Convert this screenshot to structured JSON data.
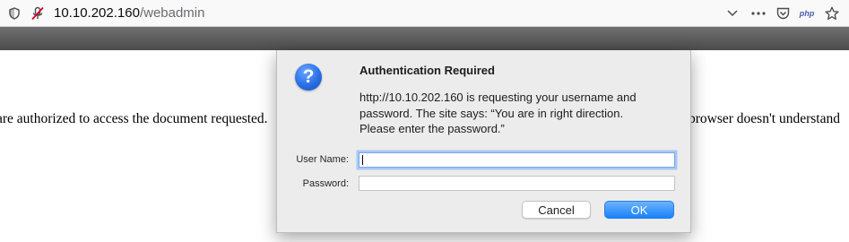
{
  "browser": {
    "url_host": "10.10.202.160",
    "url_path": "/webadmin",
    "icons": {
      "site_info": "shield-icon",
      "permissions": "blocked-microphone-icon",
      "dropdown": "chevron-down-icon",
      "page_actions": "more-dots-icon",
      "pocket": "pocket-icon",
      "extension": "php-extension-icon",
      "bookmark": "star-icon"
    },
    "extension_label": "php"
  },
  "page": {
    "left_text": "are authorized to access the document requested.",
    "right_text": "browser doesn't understand"
  },
  "dialog": {
    "icon": "question-icon",
    "icon_glyph": "?",
    "title": "Authentication Required",
    "message_lines": [
      "http://10.10.202.160 is requesting your username and",
      "password. The site says: “You are in right direction.",
      "Please enter the password.”"
    ],
    "username_label": "User Name:",
    "username_value": "",
    "password_label": "Password:",
    "password_value": "",
    "cancel_label": "Cancel",
    "ok_label": "OK",
    "accent_color": "#1a82fb"
  }
}
